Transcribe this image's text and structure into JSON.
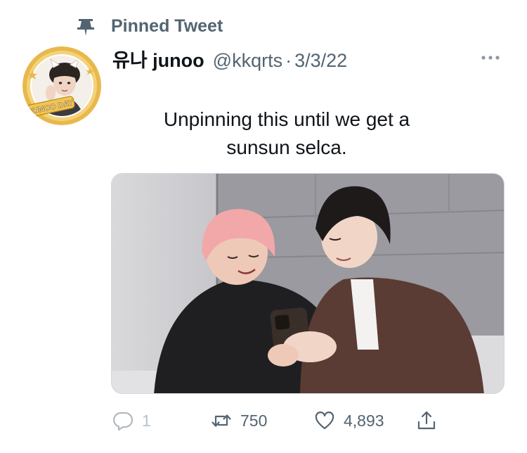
{
  "pinned": {
    "label": "Pinned Tweet",
    "icon": "pin-icon"
  },
  "author": {
    "display_name": "유나 junoo",
    "handle": "@kkqrts",
    "separator": "·",
    "date": "3/3/22",
    "avatar_badge_text": "SUNOO DAY",
    "avatar_ring_color": "#e8b84a"
  },
  "tweet": {
    "text_line1": "Unpinning this until we get a",
    "text_line2": "sunsun selca."
  },
  "actions": {
    "reply_count": "1",
    "retweet_count": "750",
    "like_count": "4,893"
  },
  "icons": {
    "more": "more-icon",
    "reply": "reply-icon",
    "retweet": "retweet-icon",
    "like": "heart-icon",
    "share": "share-icon"
  },
  "colors": {
    "text_primary": "#0f1419",
    "text_secondary": "#536471"
  }
}
